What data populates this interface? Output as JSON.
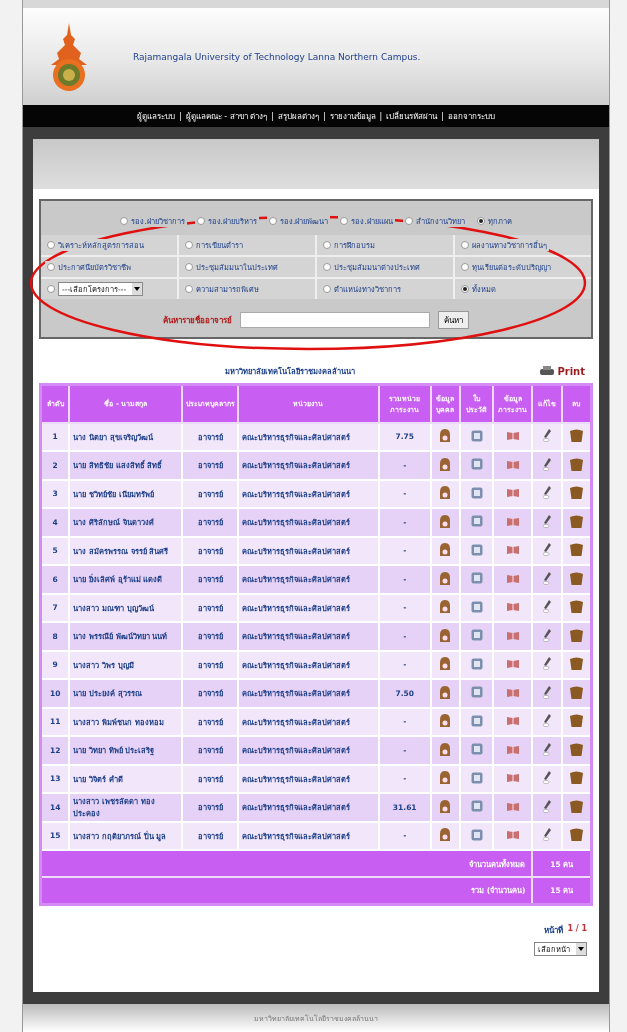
{
  "header": {
    "title": "Rajamangala University of Technology Lanna Northern Campus."
  },
  "nav": {
    "separator": "|",
    "links": [
      "ผู้ดูแลระบบ",
      "ผู้ดูแลคณะ - สาขา ต่างๆ",
      "สรุปผลต่างๆ",
      "รายงานข้อมูล",
      "เปลี่ยนรหัสผ่าน",
      "ออกจากระบบ"
    ]
  },
  "filter": {
    "groups": [
      {
        "label": "รอง.ฝ่ายวิชาการ",
        "selected": false
      },
      {
        "label": "รอง.ฝ่ายบริหาร",
        "selected": false
      },
      {
        "label": "รอง.ฝ่ายพัฒนา",
        "selected": false
      },
      {
        "label": "รอง.ฝ่ายแผน",
        "selected": false
      },
      {
        "label": "สำนักงานวิทยา",
        "selected": false
      },
      {
        "label": "ทุกภาค",
        "selected": true
      }
    ],
    "options": [
      {
        "kind": "radio",
        "label": "วิเคราะห์หลักสูตรการสอน",
        "selected": false
      },
      {
        "kind": "radio",
        "label": "การเขียนตำรา",
        "selected": false
      },
      {
        "kind": "radio",
        "label": "การฝึกอบรม",
        "selected": false
      },
      {
        "kind": "radio",
        "label": "ผลงานทางวิชาการอื่นๆ",
        "selected": false
      },
      {
        "kind": "radio",
        "label": "ประกาศนียบัตรวิชาชีพ",
        "selected": false
      },
      {
        "kind": "radio",
        "label": "ประชุมสัมมนาในประเทศ",
        "selected": false
      },
      {
        "kind": "radio",
        "label": "ประชุมสัมมนาต่างประเทศ",
        "selected": false
      },
      {
        "kind": "radio",
        "label": "ทุนเรียนต่อระดับปริญญา",
        "selected": false
      },
      {
        "kind": "select",
        "label": "---เลือกโครงการ---",
        "selected": false
      },
      {
        "kind": "radio",
        "label": "ความสามารถพิเศษ",
        "selected": false
      },
      {
        "kind": "radio",
        "label": "ตำแหน่งทางวิชาการ",
        "selected": false
      },
      {
        "kind": "radio",
        "label": "ทั้งหมด",
        "selected": true
      }
    ],
    "search_label": "ค้นหารายชื่ออาจารย์",
    "search_button": "ค้นหา"
  },
  "table_title": "มหาวิทยาลัยเทคโนโลยีราชมงคลล้านนา",
  "print": "Print",
  "table": {
    "columns": [
      "ลำดับ",
      "ชื่อ - นามสกุล",
      "ประเภทบุคลากร",
      "หน่วยงาน",
      "รวมหน่วยภาระงาน",
      "ข้อมูลบุคคล",
      "ใบประวัติ",
      "ข้อมูลภาระงาน",
      "แก้ไข",
      "ลบ"
    ],
    "rows": [
      {
        "no": "1",
        "name": "นาง นิตยา สุขเจริญวัฒน์",
        "type": "อาจารย์",
        "unit": "คณะบริหารธุรกิจและศิลปศาสตร์",
        "load": "7.75"
      },
      {
        "no": "2",
        "name": "นาย สิทธิชัย แสงสิทธิ์ สิทธิ์",
        "type": "อาจารย์",
        "unit": "คณะบริหารธุรกิจและศิลปศาสตร์",
        "load": "-"
      },
      {
        "no": "3",
        "name": "นาย ชวิทย์ชัย เนียมทรัพย์",
        "type": "อาจารย์",
        "unit": "คณะบริหารธุรกิจและศิลปศาสตร์",
        "load": "-"
      },
      {
        "no": "4",
        "name": "นาง ศิริลักษณ์ จินดาวงศ์",
        "type": "อาจารย์",
        "unit": "คณะบริหารธุรกิจและศิลปศาสตร์",
        "load": "-"
      },
      {
        "no": "5",
        "name": "นาง สมัครพรรณ จรรย์ สินศรี",
        "type": "อาจารย์",
        "unit": "คณะบริหารธุรกิจและศิลปศาสตร์",
        "load": "-"
      },
      {
        "no": "6",
        "name": "นาย ยิ่งเลิศพ์ อุร้าแม่ แดงดี",
        "type": "อาจารย์",
        "unit": "คณะบริหารธุรกิจและศิลปศาสตร์",
        "load": "-"
      },
      {
        "no": "7",
        "name": "นางสาว มณฑา บุญวัฒน์",
        "type": "อาจารย์",
        "unit": "คณะบริหารธุรกิจและศิลปศาสตร์",
        "load": "-"
      },
      {
        "no": "8",
        "name": "นาง พรรณีย์ พัฒน์วิทยา นนท์",
        "type": "อาจารย์",
        "unit": "คณะบริหารธุรกิจและศิลปศาสตร์",
        "load": "-"
      },
      {
        "no": "9",
        "name": "นางสาว วิพร บุญมี",
        "type": "อาจารย์",
        "unit": "คณะบริหารธุรกิจและศิลปศาสตร์",
        "load": "-"
      },
      {
        "no": "10",
        "name": "นาย ประยงค์ สุวรรณ",
        "type": "อาจารย์",
        "unit": "คณะบริหารธุรกิจและศิลปศาสตร์",
        "load": "7.50"
      },
      {
        "no": "11",
        "name": "นางสาว พิมพ์ชนก ทองหอม",
        "type": "อาจารย์",
        "unit": "คณะบริหารธุรกิจและศิลปศาสตร์",
        "load": "-"
      },
      {
        "no": "12",
        "name": "นาย วิทยา ทิพย์ ประเสริฐ",
        "type": "อาจารย์",
        "unit": "คณะบริหารธุรกิจและศิลปศาสตร์",
        "load": "-"
      },
      {
        "no": "13",
        "name": "นาย วิจิตร์ คำดี",
        "type": "อาจารย์",
        "unit": "คณะบริหารธุรกิจและศิลปศาสตร์",
        "load": "-"
      },
      {
        "no": "14",
        "name": "นางสาว เพชรลัดดา ทอง ประคอง",
        "type": "อาจารย์",
        "unit": "คณะบริหารธุรกิจและศิลปศาสตร์",
        "load": "31.61"
      },
      {
        "no": "15",
        "name": "นางสาว กฤติยาภรณ์ ปิ่น มูล",
        "type": "อาจารย์",
        "unit": "คณะบริหารธุรกิจและศิลปศาสตร์",
        "load": "-"
      }
    ],
    "totals": [
      {
        "label": "จำนวนคนทั้งหมด",
        "value": "15 คน"
      },
      {
        "label": "รวม (จำนวนคน)",
        "value": "15 คน"
      }
    ]
  },
  "pagination": {
    "label": "หน้าที่",
    "current": "1 / 1",
    "select": "เลือกหน้า"
  },
  "footer": "มหาวิทยาลัยเทคโนโลยีราชมงคลล้านนา"
}
